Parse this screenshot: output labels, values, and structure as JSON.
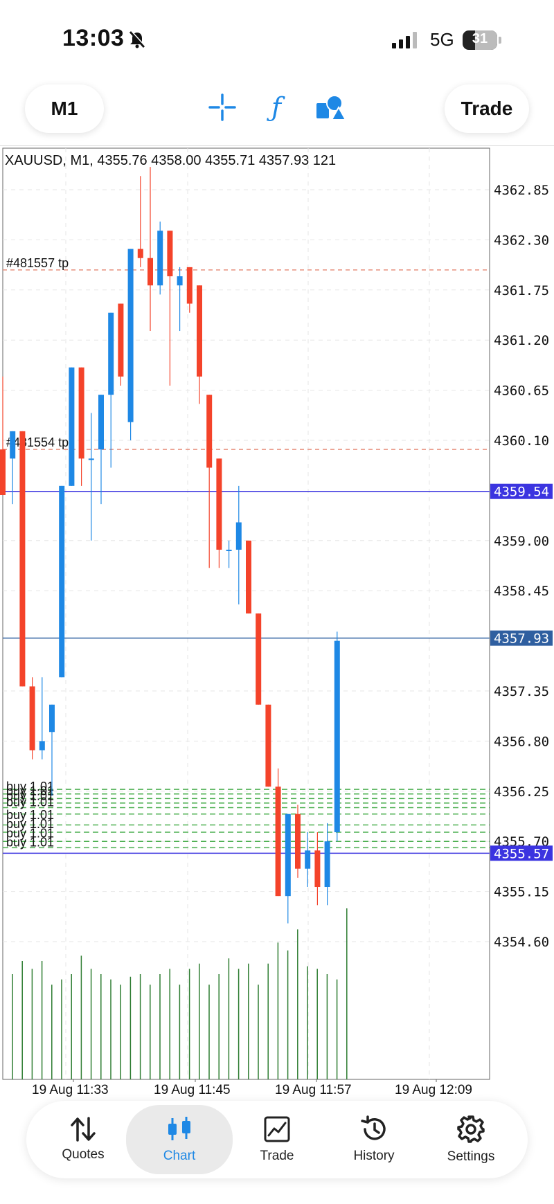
{
  "status_bar": {
    "time": "13:03",
    "network": "5G",
    "battery": "31"
  },
  "toolbar": {
    "timeframe": "M1",
    "trade_label": "Trade",
    "icons": [
      "crosshair-icon",
      "indicator-f-icon",
      "objects-icon"
    ]
  },
  "chart": {
    "info": "XAUUSD, M1, 4355.76 4358.00 4355.71 4357.93 121",
    "symbol": "XAUUSD",
    "timeframe": "M1",
    "price_labels": [
      "4362.85",
      "4362.30",
      "4361.75",
      "4361.20",
      "4360.65",
      "4360.10",
      "4359.00",
      "4358.45",
      "4357.35",
      "4356.80",
      "4356.25",
      "4355.70",
      "4355.15",
      "4354.60"
    ],
    "markers": [
      {
        "label": "4359.54",
        "price": 4359.54,
        "color": "#3b34e0"
      },
      {
        "label": "4357.93",
        "price": 4357.93,
        "color": "#2f5fa0"
      },
      {
        "label": "4355.57",
        "price": 4355.57,
        "color": "#3b34e0"
      }
    ],
    "time_labels": [
      "19 Aug 11:33",
      "19 Aug 11:45",
      "19 Aug 11:57",
      "19 Aug 12:09"
    ],
    "order_lines": [
      {
        "label": "#481557 tp",
        "price": 4361.97
      },
      {
        "label": "#481554 tp",
        "price": 4360.0
      }
    ],
    "buy_label": "buy 1.01",
    "colors": {
      "bull": "#1e88e5",
      "bear": "#f4432a",
      "volume": "#2e7d32",
      "grid": "#e6e6e6",
      "buy_line": "#4caf50",
      "tp_line": "#e8917e"
    }
  },
  "chart_data": {
    "type": "candlestick",
    "title": "XAUUSD, M1, 4355.76 4358.00 4355.71 4357.93 121",
    "ylim": [
      4354.35,
      4363.2
    ],
    "candles": [
      {
        "o": 4360.0,
        "h": 4360.8,
        "l": 4359.8,
        "c": 4359.5
      },
      {
        "o": 4359.9,
        "h": 4360.2,
        "l": 4359.4,
        "c": 4360.2
      },
      {
        "o": 4360.2,
        "h": 4360.2,
        "l": 4357.4,
        "c": 4357.4
      },
      {
        "o": 4357.4,
        "h": 4357.5,
        "l": 4356.6,
        "c": 4356.7
      },
      {
        "o": 4356.7,
        "h": 4357.5,
        "l": 4356.6,
        "c": 4356.8
      },
      {
        "o": 4356.9,
        "h": 4357.2,
        "l": 4356.2,
        "c": 4357.2
      },
      {
        "o": 4357.5,
        "h": 4359.6,
        "l": 4357.5,
        "c": 4359.6
      },
      {
        "o": 4359.6,
        "h": 4360.9,
        "l": 4359.6,
        "c": 4360.9
      },
      {
        "o": 4360.9,
        "h": 4360.9,
        "l": 4359.6,
        "c": 4359.9
      },
      {
        "o": 4359.9,
        "h": 4360.4,
        "l": 4359.0,
        "c": 4359.9
      },
      {
        "o": 4360.0,
        "h": 4360.6,
        "l": 4359.4,
        "c": 4360.6
      },
      {
        "o": 4360.6,
        "h": 4361.5,
        "l": 4359.8,
        "c": 4361.5
      },
      {
        "o": 4361.6,
        "h": 4361.6,
        "l": 4360.7,
        "c": 4360.8
      },
      {
        "o": 4360.3,
        "h": 4362.2,
        "l": 4360.1,
        "c": 4362.2
      },
      {
        "o": 4362.2,
        "h": 4363.0,
        "l": 4362.0,
        "c": 4362.1
      },
      {
        "o": 4362.1,
        "h": 4363.1,
        "l": 4361.3,
        "c": 4361.8
      },
      {
        "o": 4361.8,
        "h": 4362.5,
        "l": 4361.7,
        "c": 4362.4
      },
      {
        "o": 4362.4,
        "h": 4362.4,
        "l": 4360.7,
        "c": 4361.9
      },
      {
        "o": 4361.8,
        "h": 4362.0,
        "l": 4361.3,
        "c": 4361.9
      },
      {
        "o": 4362.0,
        "h": 4362.0,
        "l": 4361.5,
        "c": 4361.6
      },
      {
        "o": 4361.8,
        "h": 4361.8,
        "l": 4360.5,
        "c": 4360.8
      },
      {
        "o": 4360.6,
        "h": 4360.6,
        "l": 4358.7,
        "c": 4359.8
      },
      {
        "o": 4359.9,
        "h": 4359.9,
        "l": 4358.7,
        "c": 4358.9
      },
      {
        "o": 4358.9,
        "h": 4359.0,
        "l": 4358.7,
        "c": 4358.9
      },
      {
        "o": 4358.9,
        "h": 4359.6,
        "l": 4358.3,
        "c": 4359.2
      },
      {
        "o": 4359.0,
        "h": 4359.0,
        "l": 4358.2,
        "c": 4358.2
      },
      {
        "o": 4358.2,
        "h": 4358.2,
        "l": 4357.2,
        "c": 4357.2
      },
      {
        "o": 4357.2,
        "h": 4357.2,
        "l": 4356.3,
        "c": 4356.3
      },
      {
        "o": 4356.3,
        "h": 4356.5,
        "l": 4355.1,
        "c": 4355.1
      },
      {
        "o": 4355.1,
        "h": 4356.0,
        "l": 4354.8,
        "c": 4356.0
      },
      {
        "o": 4356.0,
        "h": 4356.1,
        "l": 4355.3,
        "c": 4355.4
      },
      {
        "o": 4355.4,
        "h": 4355.8,
        "l": 4355.2,
        "c": 4355.6
      },
      {
        "o": 4355.6,
        "h": 4355.8,
        "l": 4355.0,
        "c": 4355.2
      },
      {
        "o": 4355.2,
        "h": 4355.9,
        "l": 4355.0,
        "c": 4355.7
      },
      {
        "o": 4355.8,
        "h": 4358.0,
        "l": 4355.7,
        "c": 4357.9
      }
    ],
    "volume": [
      80,
      90,
      84,
      90,
      72,
      76,
      80,
      94,
      84,
      80,
      76,
      72,
      78,
      80,
      72,
      80,
      84,
      72,
      84,
      88,
      72,
      80,
      92,
      84,
      88,
      72,
      88,
      104,
      98,
      114,
      86,
      84,
      80,
      76,
      130
    ]
  },
  "nav": {
    "items": [
      {
        "label": "Quotes",
        "icon": "quotes-icon"
      },
      {
        "label": "Chart",
        "icon": "chart-candles-icon"
      },
      {
        "label": "Trade",
        "icon": "trade-chart-icon"
      },
      {
        "label": "History",
        "icon": "history-icon"
      },
      {
        "label": "Settings",
        "icon": "settings-gear-icon"
      }
    ]
  }
}
